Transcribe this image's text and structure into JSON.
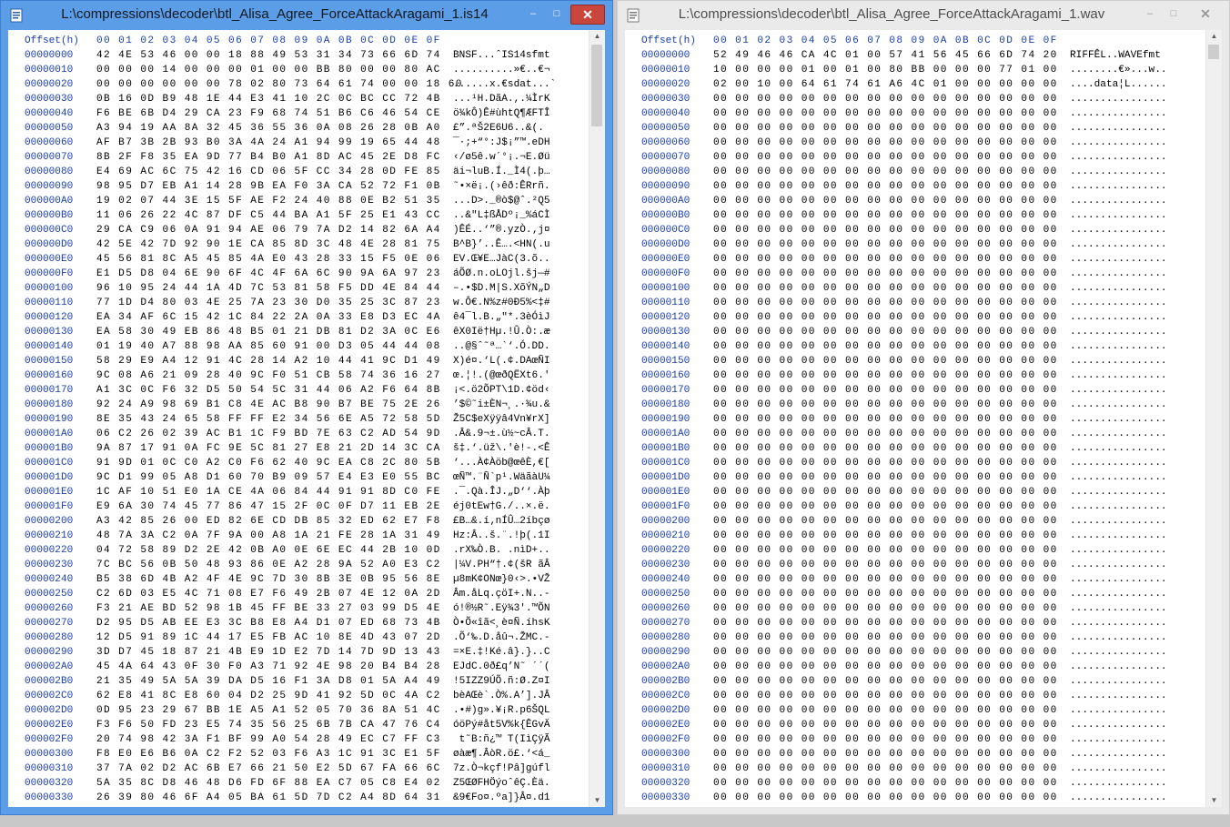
{
  "windows": [
    {
      "title": "L:\\compressions\\decoder\\btl_Alisa_Agree_ForceAttackAragami_1.is14",
      "icon": "hex-file-icon",
      "controls": {
        "minimize": "–",
        "maximize": "□",
        "close": "✕"
      },
      "header": {
        "offset": "Offset(h)",
        "columns": "00 01 02 03 04 05 06 07 08 09 0A 0B 0C 0D 0E 0F"
      },
      "rows": [
        {
          "offset": "00000000",
          "hex": "42 4E 53 46 00 00 18 88 49 53 31 34 73 66 6D 74",
          "text": "BNSF...ˆIS14sfmt"
        },
        {
          "offset": "00000010",
          "hex": "00 00 00 14 00 00 00 01 00 00 BB 80 00 00 80 AC",
          "text": "..........»€..€¬"
        },
        {
          "offset": "00000020",
          "hex": "00 00 00 00 00 00 78 02 80 73 64 61 74 00 00 18 60",
          "text": "......x.€sdat...`"
        },
        {
          "offset": "00000030",
          "hex": "0B 16 0D B9 48 1E 44 E3 41 10 2C 0C BC CC 72 4B",
          "text": "...¹H.DãA.,.¼ÌrK"
        },
        {
          "offset": "00000040",
          "hex": "F6 BE 6B D4 29 CA 23 F9 68 74 51 B6 C6 46 54 CE",
          "text": "ö¾kÔ)Ê#ùhtQ¶ÆFTÎ"
        },
        {
          "offset": "00000050",
          "hex": "A3 94 19 AA 8A 32 45 36 55 36 0A 08 26 28 0B A0",
          "text": "£”.ªŠ2E6U6..&(. "
        },
        {
          "offset": "00000060",
          "hex": "AF B7 3B 2B 93 B0 3A 4A 24 A1 94 99 19 65 44 48",
          "text": "¯·;+“°:J$¡”™.eDH"
        },
        {
          "offset": "00000070",
          "hex": "8B 2F F8 35 EA 9D 77 B4 B0 A1 8D AC 45 2E D8 FC",
          "text": "‹/ø5ê.w´°¡.¬E.Øü"
        },
        {
          "offset": "00000080",
          "hex": "E4 69 AC 6C 75 42 16 CD 06 5F CC 34 28 0D FE 85",
          "text": "äi¬luB.Í._Ì4(.þ…"
        },
        {
          "offset": "00000090",
          "hex": "98 95 D7 EB A1 14 28 9B EA F0 3A CA 52 72 F1 0B",
          "text": "˜•×ë¡.(›êð:ÊRrñ."
        },
        {
          "offset": "000000A0",
          "hex": "19 02 07 44 3E 15 5F AE F2 24 40 88 0E B2 51 35",
          "text": "...D>._®ò$@ˆ.²Q5"
        },
        {
          "offset": "000000B0",
          "hex": "11 06 26 22 4C 87 DF C5 44 BA A1 5F 25 E1 43 CC",
          "text": "..&\"L‡ßÅDº¡_%áCÌ"
        },
        {
          "offset": "000000C0",
          "hex": "29 CA C9 06 0A 91 94 AE 06 79 7A D2 14 82 6A A4",
          "text": ")ÊÉ..‘”®.yzÒ.‚j¤"
        },
        {
          "offset": "000000D0",
          "hex": "42 5E 42 7D 92 90 1E CA 85 8D 3C 48 4E 28 81 75",
          "text": "B^B}’..Ê….<HN(.u"
        },
        {
          "offset": "000000E0",
          "hex": "45 56 81 8C A5 45 85 4A E0 43 28 33 15 F5 0E 06",
          "text": "EV.Œ¥E…JàC(3.õ.."
        },
        {
          "offset": "000000F0",
          "hex": "E1 D5 D8 04 6E 90 6F 4C 4F 6A 6C 90 9A 6A 97 23",
          "text": "áÕØ.n.oLOjl.šj—#"
        },
        {
          "offset": "00000100",
          "hex": "96 10 95 24 44 1A 4D 7C 53 81 58 F5 DD 4E 84 44",
          "text": "–.•$D.M|S.XõÝN„D"
        },
        {
          "offset": "00000110",
          "hex": "77 1D D4 80 03 4E 25 7A 23 30 D0 35 25 3C 87 23",
          "text": "w.Ô€.N%z#0Ð5%<‡#"
        },
        {
          "offset": "00000120",
          "hex": "EA 34 AF 6C 15 42 1C 84 22 2A 0A 33 E8 D3 EC 4A",
          "text": "ê4¯l.B.„\"*.3èÓìJ"
        },
        {
          "offset": "00000130",
          "hex": "EA 58 30 49 EB 86 48 B5 01 21 DB 81 D2 3A 0C E6",
          "text": "êX0Ië†Hµ.!Û.Ò:.æ"
        },
        {
          "offset": "00000140",
          "hex": "01 19 40 A7 88 98 AA 85 60 91 00 D3 05 44 44 08",
          "text": "..@§ˆ˜ª…`‘.Ó.DD."
        },
        {
          "offset": "00000150",
          "hex": "58 29 E9 A4 12 91 4C 28 14 A2 10 44 41 9C D1 49",
          "text": "X)é¤.‘L(.¢.DAœÑI"
        },
        {
          "offset": "00000160",
          "hex": "9C 08 A6 21 09 28 40 9C F0 51 CB 58 74 36 16 27",
          "text": "œ.¦!.(@œðQËXt6.'"
        },
        {
          "offset": "00000170",
          "hex": "A1 3C 0C F6 32 D5 50 54 5C 31 44 06 A2 F6 64 8B",
          "text": "¡<.ö2ÕPT\\1D.¢öd‹"
        },
        {
          "offset": "00000180",
          "hex": "92 24 A9 98 69 B1 C8 4E AC B8 90 B7 BE 75 2E 26",
          "text": "’$©˜i±ÈN¬¸.·¾u.&"
        },
        {
          "offset": "00000190",
          "hex": "8E 35 43 24 65 58 FF FF E2 34 56 6E A5 72 58 5D",
          "text": "Ž5C$eXÿÿâ4Vn¥rX]"
        },
        {
          "offset": "000001A0",
          "hex": "06 C2 26 02 39 AC B1 1C F9 BD 7E 63 C2 AD 54 9D",
          "text": ".Â&.9¬±.ù½~cÂ.T."
        },
        {
          "offset": "000001B0",
          "hex": "9A 87 17 91 0A FC 9E 5C 81 27 E8 21 2D 14 3C CA",
          "text": "š‡.‘.üž\\.'è!-.<Ê"
        },
        {
          "offset": "000001C0",
          "hex": "91 9D 01 0C C0 A2 C0 F6 62 40 9C EA C8 2C 80 5B",
          "text": "‘...À¢Àöb@œêÈ,€["
        },
        {
          "offset": "000001D0",
          "hex": "9C D1 99 05 A8 D1 60 70 B9 09 57 E4 E3 E0 55 BC",
          "text": "œÑ™.¨Ñ`p¹.WäãàU¼"
        },
        {
          "offset": "000001E0",
          "hex": "1C AF 10 51 E0 1A CE 4A 06 84 44 91 91 8D C0 FE",
          "text": ".¯.Qà.ÎJ.„D‘‘.Àþ"
        },
        {
          "offset": "000001F0",
          "hex": "E9 6A 30 74 45 77 86 47 15 2F 0C 0F D7 11 EB 2E",
          "text": "éj0tEw†G./..×.ë."
        },
        {
          "offset": "00000200",
          "hex": "A3 42 85 26 00 ED 82 6E CD DB 85 32 ED 62 E7 F8",
          "text": "£B…&.í‚nÍÛ…2íbçø"
        },
        {
          "offset": "00000210",
          "hex": "48 7A 3A C2 0A 7F 9A 00 A8 1A 21 FE 28 1A 31 49",
          "text": "Hz:Â..š.¨.!þ(.1I"
        },
        {
          "offset": "00000220",
          "hex": "04 72 58 89 D2 2E 42 0B A0 0E 6E EC 44 2B 10 0D",
          "text": ".rX‰Ò.B. .nìD+.."
        },
        {
          "offset": "00000230",
          "hex": "7C BC 56 0B 50 48 93 86 0E A2 28 9A 52 A0 E3 C2",
          "text": "|¼V.PH“†.¢(šR ãÂ"
        },
        {
          "offset": "00000240",
          "hex": "B5 38 6D 4B A2 4F 4E 9C 7D 30 8B 3E 0B 95 56 8E",
          "text": "µ8mK¢ONœ}0‹>.•VŽ"
        },
        {
          "offset": "00000250",
          "hex": "C2 6D 03 E5 4C 71 08 E7 F6 49 2B 07 4E 12 0A 2D",
          "text": "Âm.åLq.çöI+.N..-"
        },
        {
          "offset": "00000260",
          "hex": "F3 21 AE BD 52 98 1B 45 FF BE 33 27 03 99 D5 4E",
          "text": "ó!®½R˜.Eÿ¾3'.™ÕN"
        },
        {
          "offset": "00000270",
          "hex": "D2 95 D5 AB EE E3 3C B8 E8 A4 D1 07 ED 68 73 4B",
          "text": "Ò•Õ«îã<¸è¤Ñ.íhsK"
        },
        {
          "offset": "00000280",
          "hex": "12 D5 91 89 1C 44 17 E5 FB AC 10 8E 4D 43 07 2D",
          "text": ".Õ‘‰.D.åû¬.ŽMC.-"
        },
        {
          "offset": "00000290",
          "hex": "3D D7 45 18 87 21 4B E9 1D E2 7D 14 7D 9D 13 43",
          "text": "=×E.‡!Ké.â}.}..C"
        },
        {
          "offset": "000002A0",
          "hex": "45 4A 64 43 0F 30 F0 A3 71 92 4E 98 20 B4 B4 28",
          "text": "EJdC.0ð£q’N˜ ´´("
        },
        {
          "offset": "000002B0",
          "hex": "21 35 49 5A 5A 39 DA D5 16 F1 3A D8 01 5A A4 49",
          "text": "!5IZZ9ÚÕ.ñ:Ø.Z¤I"
        },
        {
          "offset": "000002C0",
          "hex": "62 E8 41 8C E8 60 04 D2 25 9D 41 92 5D 0C 4A C2",
          "text": "bèAŒè`.Ò%.A’].JÂ"
        },
        {
          "offset": "000002D0",
          "hex": "0D 95 23 29 67 BB 1E A5 A1 52 05 70 36 8A 51 4C",
          "text": ".•#)g».¥¡R.p6ŠQL"
        },
        {
          "offset": "000002E0",
          "hex": "F3 F6 50 FD 23 E5 74 35 56 25 6B 7B CA 47 76 C4",
          "text": "óöPý#åt5V%k{ÊGvÄ"
        },
        {
          "offset": "000002F0",
          "hex": "20 74 98 42 3A F1 BF 99 A0 54 28 49 EC C7 FF C3",
          "text": " t˜B:ñ¿™ T(IìÇÿÃ"
        },
        {
          "offset": "00000300",
          "hex": "F8 E0 E6 B6 0A C2 F2 52 03 F6 A3 1C 91 3C E1 5F",
          "text": "øàæ¶.ÂòR.ö£.‘<á_"
        },
        {
          "offset": "00000310",
          "hex": "37 7A 02 D2 AC 6B E7 66 21 50 E2 5D 67 FA 66 6C",
          "text": "7z.Ò¬kçf!Pâ]gúfl"
        },
        {
          "offset": "00000320",
          "hex": "5A 35 8C D8 46 48 D6 FD 6F 88 EA C7 05 C8 E4 02",
          "text": "Z5ŒØFHÖýoˆêÇ.Èä."
        },
        {
          "offset": "00000330",
          "hex": "26 39 80 46 6F A4 05 BA 61 5D 7D C2 A4 8D 64 31",
          "text": "&9€Fo¤.ºa]}Â¤.d1"
        }
      ]
    },
    {
      "title": "L:\\compressions\\decoder\\btl_Alisa_Agree_ForceAttackAragami_1.wav",
      "icon": "hex-file-icon",
      "controls": {
        "minimize": "–",
        "maximize": "□",
        "close": "✕"
      },
      "header": {
        "offset": "Offset(h)",
        "columns": "00 01 02 03 04 05 06 07 08 09 0A 0B 0C 0D 0E 0F"
      },
      "rows": [
        {
          "offset": "00000000",
          "hex": "52 49 46 46 CA 4C 01 00 57 41 56 45 66 6D 74 20",
          "text": "RIFFÊL..WAVEfmt "
        },
        {
          "offset": "00000010",
          "hex": "10 00 00 00 01 00 01 00 80 BB 00 00 00 77 01 00",
          "text": "........€»...w.."
        },
        {
          "offset": "00000020",
          "hex": "02 00 10 00 64 61 74 61 A6 4C 01 00 00 00 00 00",
          "text": "....data¦L......"
        },
        {
          "offset": "00000030",
          "hex": "00 00 00 00 00 00 00 00 00 00 00 00 00 00 00 00",
          "text": "................"
        },
        {
          "offset": "00000040",
          "hex": "00 00 00 00 00 00 00 00 00 00 00 00 00 00 00 00",
          "text": "................"
        },
        {
          "offset": "00000050",
          "hex": "00 00 00 00 00 00 00 00 00 00 00 00 00 00 00 00",
          "text": "................"
        },
        {
          "offset": "00000060",
          "hex": "00 00 00 00 00 00 00 00 00 00 00 00 00 00 00 00",
          "text": "................"
        },
        {
          "offset": "00000070",
          "hex": "00 00 00 00 00 00 00 00 00 00 00 00 00 00 00 00",
          "text": "................"
        },
        {
          "offset": "00000080",
          "hex": "00 00 00 00 00 00 00 00 00 00 00 00 00 00 00 00",
          "text": "................"
        },
        {
          "offset": "00000090",
          "hex": "00 00 00 00 00 00 00 00 00 00 00 00 00 00 00 00",
          "text": "................"
        },
        {
          "offset": "000000A0",
          "hex": "00 00 00 00 00 00 00 00 00 00 00 00 00 00 00 00",
          "text": "................"
        },
        {
          "offset": "000000B0",
          "hex": "00 00 00 00 00 00 00 00 00 00 00 00 00 00 00 00",
          "text": "................"
        },
        {
          "offset": "000000C0",
          "hex": "00 00 00 00 00 00 00 00 00 00 00 00 00 00 00 00",
          "text": "................"
        },
        {
          "offset": "000000D0",
          "hex": "00 00 00 00 00 00 00 00 00 00 00 00 00 00 00 00",
          "text": "................"
        },
        {
          "offset": "000000E0",
          "hex": "00 00 00 00 00 00 00 00 00 00 00 00 00 00 00 00",
          "text": "................"
        },
        {
          "offset": "000000F0",
          "hex": "00 00 00 00 00 00 00 00 00 00 00 00 00 00 00 00",
          "text": "................"
        },
        {
          "offset": "00000100",
          "hex": "00 00 00 00 00 00 00 00 00 00 00 00 00 00 00 00",
          "text": "................"
        },
        {
          "offset": "00000110",
          "hex": "00 00 00 00 00 00 00 00 00 00 00 00 00 00 00 00",
          "text": "................"
        },
        {
          "offset": "00000120",
          "hex": "00 00 00 00 00 00 00 00 00 00 00 00 00 00 00 00",
          "text": "................"
        },
        {
          "offset": "00000130",
          "hex": "00 00 00 00 00 00 00 00 00 00 00 00 00 00 00 00",
          "text": "................"
        },
        {
          "offset": "00000140",
          "hex": "00 00 00 00 00 00 00 00 00 00 00 00 00 00 00 00",
          "text": "................"
        },
        {
          "offset": "00000150",
          "hex": "00 00 00 00 00 00 00 00 00 00 00 00 00 00 00 00",
          "text": "................"
        },
        {
          "offset": "00000160",
          "hex": "00 00 00 00 00 00 00 00 00 00 00 00 00 00 00 00",
          "text": "................"
        },
        {
          "offset": "00000170",
          "hex": "00 00 00 00 00 00 00 00 00 00 00 00 00 00 00 00",
          "text": "................"
        },
        {
          "offset": "00000180",
          "hex": "00 00 00 00 00 00 00 00 00 00 00 00 00 00 00 00",
          "text": "................"
        },
        {
          "offset": "00000190",
          "hex": "00 00 00 00 00 00 00 00 00 00 00 00 00 00 00 00",
          "text": "................"
        },
        {
          "offset": "000001A0",
          "hex": "00 00 00 00 00 00 00 00 00 00 00 00 00 00 00 00",
          "text": "................"
        },
        {
          "offset": "000001B0",
          "hex": "00 00 00 00 00 00 00 00 00 00 00 00 00 00 00 00",
          "text": "................"
        },
        {
          "offset": "000001C0",
          "hex": "00 00 00 00 00 00 00 00 00 00 00 00 00 00 00 00",
          "text": "................"
        },
        {
          "offset": "000001D0",
          "hex": "00 00 00 00 00 00 00 00 00 00 00 00 00 00 00 00",
          "text": "................"
        },
        {
          "offset": "000001E0",
          "hex": "00 00 00 00 00 00 00 00 00 00 00 00 00 00 00 00",
          "text": "................"
        },
        {
          "offset": "000001F0",
          "hex": "00 00 00 00 00 00 00 00 00 00 00 00 00 00 00 00",
          "text": "................"
        },
        {
          "offset": "00000200",
          "hex": "00 00 00 00 00 00 00 00 00 00 00 00 00 00 00 00",
          "text": "................"
        },
        {
          "offset": "00000210",
          "hex": "00 00 00 00 00 00 00 00 00 00 00 00 00 00 00 00",
          "text": "................"
        },
        {
          "offset": "00000220",
          "hex": "00 00 00 00 00 00 00 00 00 00 00 00 00 00 00 00",
          "text": "................"
        },
        {
          "offset": "00000230",
          "hex": "00 00 00 00 00 00 00 00 00 00 00 00 00 00 00 00",
          "text": "................"
        },
        {
          "offset": "00000240",
          "hex": "00 00 00 00 00 00 00 00 00 00 00 00 00 00 00 00",
          "text": "................"
        },
        {
          "offset": "00000250",
          "hex": "00 00 00 00 00 00 00 00 00 00 00 00 00 00 00 00",
          "text": "................"
        },
        {
          "offset": "00000260",
          "hex": "00 00 00 00 00 00 00 00 00 00 00 00 00 00 00 00",
          "text": "................"
        },
        {
          "offset": "00000270",
          "hex": "00 00 00 00 00 00 00 00 00 00 00 00 00 00 00 00",
          "text": "................"
        },
        {
          "offset": "00000280",
          "hex": "00 00 00 00 00 00 00 00 00 00 00 00 00 00 00 00",
          "text": "................"
        },
        {
          "offset": "00000290",
          "hex": "00 00 00 00 00 00 00 00 00 00 00 00 00 00 00 00",
          "text": "................"
        },
        {
          "offset": "000002A0",
          "hex": "00 00 00 00 00 00 00 00 00 00 00 00 00 00 00 00",
          "text": "................"
        },
        {
          "offset": "000002B0",
          "hex": "00 00 00 00 00 00 00 00 00 00 00 00 00 00 00 00",
          "text": "................"
        },
        {
          "offset": "000002C0",
          "hex": "00 00 00 00 00 00 00 00 00 00 00 00 00 00 00 00",
          "text": "................"
        },
        {
          "offset": "000002D0",
          "hex": "00 00 00 00 00 00 00 00 00 00 00 00 00 00 00 00",
          "text": "................"
        },
        {
          "offset": "000002E0",
          "hex": "00 00 00 00 00 00 00 00 00 00 00 00 00 00 00 00",
          "text": "................"
        },
        {
          "offset": "000002F0",
          "hex": "00 00 00 00 00 00 00 00 00 00 00 00 00 00 00 00",
          "text": "................"
        },
        {
          "offset": "00000300",
          "hex": "00 00 00 00 00 00 00 00 00 00 00 00 00 00 00 00",
          "text": "................"
        },
        {
          "offset": "00000310",
          "hex": "00 00 00 00 00 00 00 00 00 00 00 00 00 00 00 00",
          "text": "................"
        },
        {
          "offset": "00000320",
          "hex": "00 00 00 00 00 00 00 00 00 00 00 00 00 00 00 00",
          "text": "................"
        },
        {
          "offset": "00000330",
          "hex": "00 00 00 00 00 00 00 00 00 00 00 00 00 00 00 00",
          "text": "................"
        }
      ]
    }
  ],
  "scrollbar": {
    "up": "▲",
    "down": "▼"
  }
}
